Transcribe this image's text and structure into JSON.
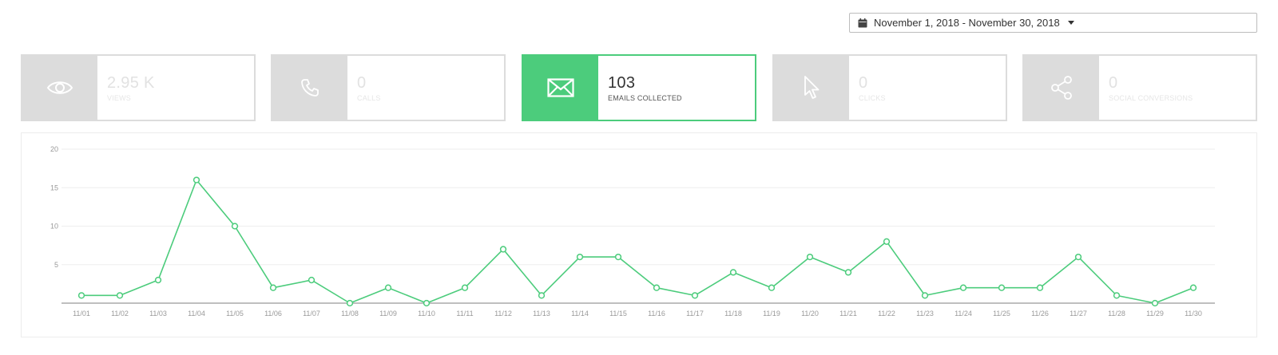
{
  "date_range": {
    "label": "November 1, 2018 - November 30, 2018",
    "icon": "calendar-icon"
  },
  "cards": [
    {
      "key": "views",
      "value": "2.95 K",
      "label": "VIEWS",
      "icon": "eye-icon",
      "active": false
    },
    {
      "key": "calls",
      "value": "0",
      "label": "CALLS",
      "icon": "phone-icon",
      "active": false
    },
    {
      "key": "emails",
      "value": "103",
      "label": "EMAILS COLLECTED",
      "icon": "envelope-icon",
      "active": true
    },
    {
      "key": "clicks",
      "value": "0",
      "label": "CLICKS",
      "icon": "cursor-icon",
      "active": false
    },
    {
      "key": "social",
      "value": "0",
      "label": "SOCIAL CONVERSIONS",
      "icon": "share-icon",
      "active": false
    }
  ],
  "colors": {
    "accent": "#4ccc7c",
    "inactive": "#dcdcdc",
    "grid": "#eeeeee",
    "axis": "#999999"
  },
  "chart_data": {
    "type": "line",
    "categories": [
      "11/01",
      "11/02",
      "11/03",
      "11/04",
      "11/05",
      "11/06",
      "11/07",
      "11/08",
      "11/09",
      "11/10",
      "11/11",
      "11/12",
      "11/13",
      "11/14",
      "11/15",
      "11/16",
      "11/17",
      "11/18",
      "11/19",
      "11/20",
      "11/21",
      "11/22",
      "11/23",
      "11/24",
      "11/25",
      "11/26",
      "11/27",
      "11/28",
      "11/29",
      "11/30"
    ],
    "values": [
      1,
      1,
      3,
      16,
      10,
      2,
      3,
      0,
      2,
      0,
      2,
      7,
      1,
      6,
      6,
      2,
      1,
      4,
      2,
      6,
      4,
      8,
      1,
      2,
      2,
      2,
      6,
      1,
      0,
      2
    ],
    "ylim": [
      0,
      20
    ],
    "yticks": [
      5,
      10,
      15,
      20
    ],
    "grid": true,
    "legend": "none"
  }
}
